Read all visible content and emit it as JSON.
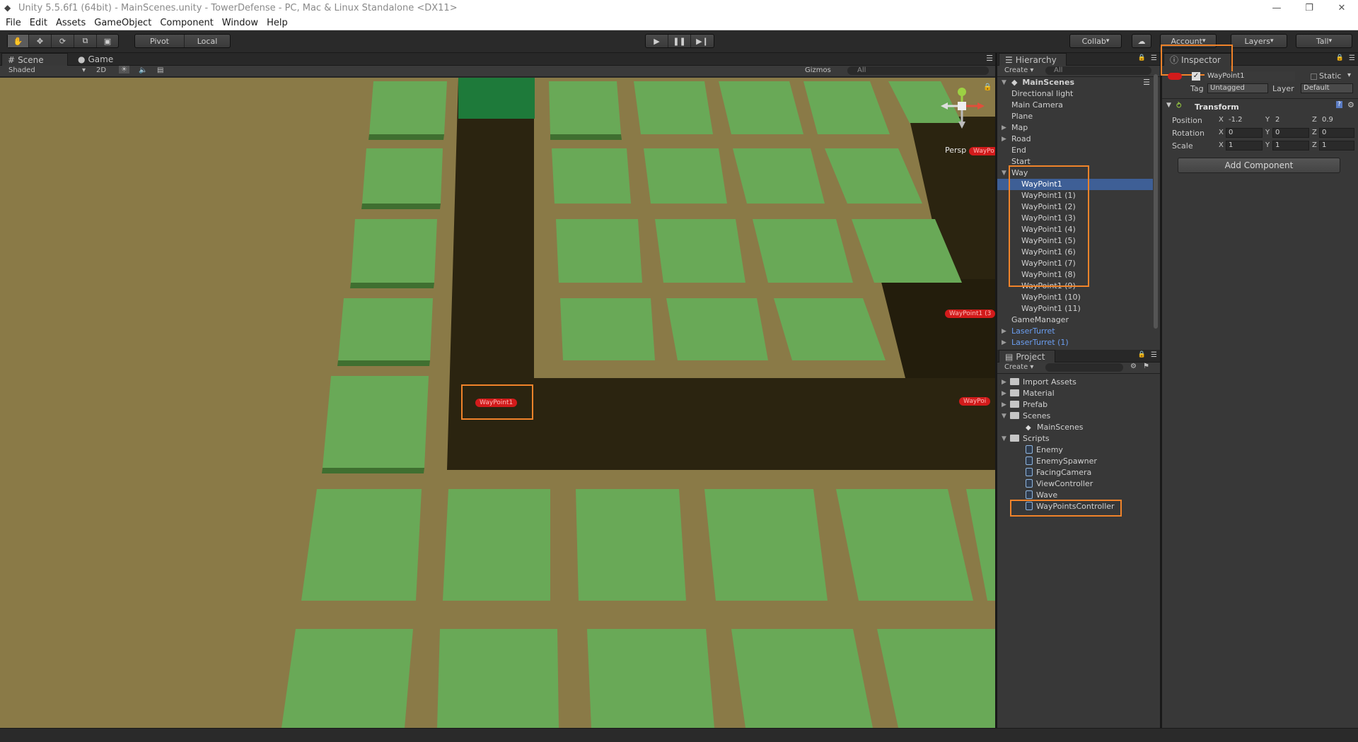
{
  "window": {
    "title": "Unity 5.5.6f1 (64bit) - MainScenes.unity - TowerDefense - PC, Mac & Linux Standalone <DX11>"
  },
  "menu": [
    "File",
    "Edit",
    "Assets",
    "GameObject",
    "Component",
    "Window",
    "Help"
  ],
  "toolbar": {
    "pivot": "Pivot",
    "local": "Local",
    "collab": "Collab",
    "account": "Account",
    "layers": "Layers",
    "layout": "Tall"
  },
  "scene_panel": {
    "tabs": [
      "Scene",
      "Game"
    ],
    "shading": "Shaded",
    "mode_2d": "2D",
    "gizmos": "Gizmos",
    "search_placeholder": "All",
    "persp_label": "Persp",
    "waypoint_label": "WayPoint1",
    "waypoint_label_far": "WayPoint1 (3",
    "waypoint_label_edge": "WayPoi",
    "waypoint_label_top": "WayPo"
  },
  "hierarchy": {
    "title": "Hierarchy",
    "create": "Create",
    "search_placeholder": "All",
    "scene_name": "MainScenes",
    "items": [
      {
        "label": "Directional light",
        "depth": 1
      },
      {
        "label": "Main Camera",
        "depth": 1
      },
      {
        "label": "Plane",
        "depth": 1
      },
      {
        "label": "Map",
        "depth": 1,
        "arrow": "right"
      },
      {
        "label": "Road",
        "depth": 1,
        "arrow": "right"
      },
      {
        "label": "End",
        "depth": 1
      },
      {
        "label": "Start",
        "depth": 1
      },
      {
        "label": "Way",
        "depth": 1,
        "arrow": "down"
      },
      {
        "label": "WayPoint1",
        "depth": 2,
        "selected": true
      },
      {
        "label": "WayPoint1 (1)",
        "depth": 2
      },
      {
        "label": "WayPoint1 (2)",
        "depth": 2
      },
      {
        "label": "WayPoint1 (3)",
        "depth": 2
      },
      {
        "label": "WayPoint1 (4)",
        "depth": 2
      },
      {
        "label": "WayPoint1 (5)",
        "depth": 2
      },
      {
        "label": "WayPoint1 (6)",
        "depth": 2
      },
      {
        "label": "WayPoint1 (7)",
        "depth": 2
      },
      {
        "label": "WayPoint1 (8)",
        "depth": 2
      },
      {
        "label": "WayPoint1 (9)",
        "depth": 2
      },
      {
        "label": "WayPoint1 (10)",
        "depth": 2
      },
      {
        "label": "WayPoint1 (11)",
        "depth": 2
      },
      {
        "label": "GameManager",
        "depth": 1
      },
      {
        "label": "LaserTurret",
        "depth": 1,
        "arrow": "right",
        "prefab": true
      },
      {
        "label": "LaserTurret (1)",
        "depth": 1,
        "arrow": "right",
        "prefab": true
      }
    ]
  },
  "project": {
    "title": "Project",
    "create": "Create",
    "items": [
      {
        "label": "Import Assets",
        "type": "folder",
        "depth": 0,
        "arrow": "right"
      },
      {
        "label": "Material",
        "type": "folder",
        "depth": 0,
        "arrow": "right"
      },
      {
        "label": "Prefab",
        "type": "folder",
        "depth": 0,
        "arrow": "right"
      },
      {
        "label": "Scenes",
        "type": "folder",
        "depth": 0,
        "arrow": "down"
      },
      {
        "label": "MainScenes",
        "type": "scene",
        "depth": 1
      },
      {
        "label": "Scripts",
        "type": "folder",
        "depth": 0,
        "arrow": "down"
      },
      {
        "label": "Enemy",
        "type": "script",
        "depth": 1
      },
      {
        "label": "EnemySpawner",
        "type": "script",
        "depth": 1
      },
      {
        "label": "FacingCamera",
        "type": "script",
        "depth": 1
      },
      {
        "label": "ViewController",
        "type": "script",
        "depth": 1
      },
      {
        "label": "Wave",
        "type": "script",
        "depth": 1
      },
      {
        "label": "WayPointsController",
        "type": "script",
        "depth": 1
      }
    ]
  },
  "inspector": {
    "title": "Inspector",
    "object_name": "WayPoint1",
    "static_label": "Static",
    "tag_label": "Tag",
    "tag_value": "Untagged",
    "layer_label": "Layer",
    "layer_value": "Default",
    "transform_title": "Transform",
    "position_label": "Position",
    "rotation_label": "Rotation",
    "scale_label": "Scale",
    "position": {
      "x": "-1.2",
      "y": "2",
      "z": "0.9"
    },
    "rotation": {
      "x": "0",
      "y": "0",
      "z": "0"
    },
    "scale": {
      "x": "1",
      "y": "1",
      "z": "1"
    },
    "add_component": "Add Component"
  },
  "colors": {
    "highlight": "#f0832a",
    "tile": "#69a957",
    "ground": "#8a7a47",
    "road": "#2b2410",
    "selection": "#3e5f96"
  }
}
